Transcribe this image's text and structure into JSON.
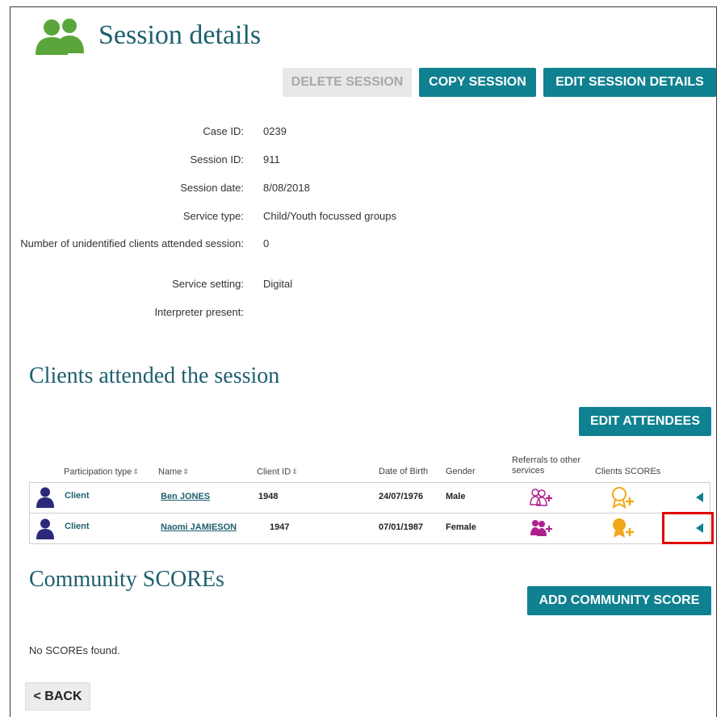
{
  "header": {
    "title": "Session details"
  },
  "actions": {
    "delete_label": "DELETE SESSION",
    "copy_label": "COPY SESSION",
    "edit_label": "EDIT SESSION DETAILS"
  },
  "details": [
    {
      "label": "Case ID:",
      "value": "0239"
    },
    {
      "label": "Session ID:",
      "value": "911"
    },
    {
      "label": "Session date:",
      "value": "8/08/2018"
    },
    {
      "label": "Service type:",
      "value": "Child/Youth focussed groups"
    },
    {
      "label": "Number of unidentified clients attended session:",
      "value": "0"
    },
    {
      "label": "Service setting:",
      "value": "Digital"
    },
    {
      "label": "Interpreter present:",
      "value": ""
    }
  ],
  "clients_section": {
    "title": "Clients attended the session",
    "edit_attendees_label": "EDIT ATTENDEES",
    "columns": {
      "participation_type": "Participation type",
      "name": "Name",
      "client_id": "Client ID",
      "dob": "Date of Birth",
      "gender": "Gender",
      "referrals": "Referrals to other services",
      "scores": "Clients SCOREs"
    },
    "rows": [
      {
        "type": "Client",
        "name": "Ben JONES",
        "client_id": "1948",
        "dob": "24/07/1976",
        "gender": "Male",
        "referral_state": "outline",
        "score_state": "outline"
      },
      {
        "type": "Client",
        "name": "Naomi JAMIESON",
        "client_id": "1947",
        "dob": "07/01/1987",
        "gender": "Female",
        "referral_state": "filled",
        "score_state": "filled"
      }
    ]
  },
  "community_section": {
    "title": "Community SCOREs",
    "add_label": "ADD COMMUNITY SCORE",
    "empty_text": "No SCOREs found."
  },
  "back_label": "< BACK",
  "colors": {
    "accent": "#0f8190",
    "heading": "#1e5f6f",
    "logo_green": "#5aa63a",
    "person_icon": "#2b2a7a",
    "referral_icon": "#b0208c",
    "score_icon": "#f0a818",
    "highlight": "#e00000"
  },
  "icons": [
    "people-group-icon",
    "person-icon",
    "add-referral-icon",
    "add-score-icon",
    "expand-arrow-icon",
    "sort-icon"
  ]
}
